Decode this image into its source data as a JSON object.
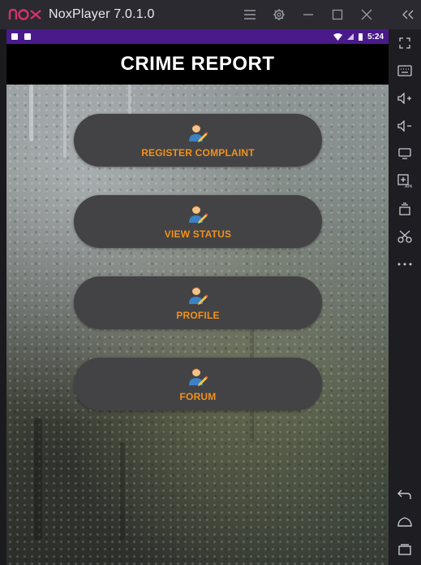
{
  "window": {
    "title": "NoxPlayer 7.0.1.0",
    "logo_text": "nox"
  },
  "statusbar": {
    "time": "5:24"
  },
  "app": {
    "title": "CRIME REPORT",
    "buttons": [
      {
        "label": "REGISTER COMPLAINT",
        "icon": "user-edit-icon"
      },
      {
        "label": "VIEW STATUS",
        "icon": "user-edit-icon"
      },
      {
        "label": "PROFILE",
        "icon": "user-edit-icon"
      },
      {
        "label": "FORUM",
        "icon": "user-edit-icon"
      }
    ]
  },
  "colors": {
    "accent_label": "#f0921e",
    "button_bg": "#434345",
    "statusbar": "#4a1a8a",
    "nox_logo": "#d2336c"
  },
  "sidebar": {
    "icons": [
      "expand-icon",
      "keyboard-icon",
      "volume-up-icon",
      "volume-down-icon",
      "screen-icon",
      "apk-install-icon",
      "multi-instance-icon",
      "scissors-icon",
      "more-icon"
    ],
    "nav_icons": [
      "back-icon",
      "home-icon",
      "recent-apps-icon"
    ]
  }
}
